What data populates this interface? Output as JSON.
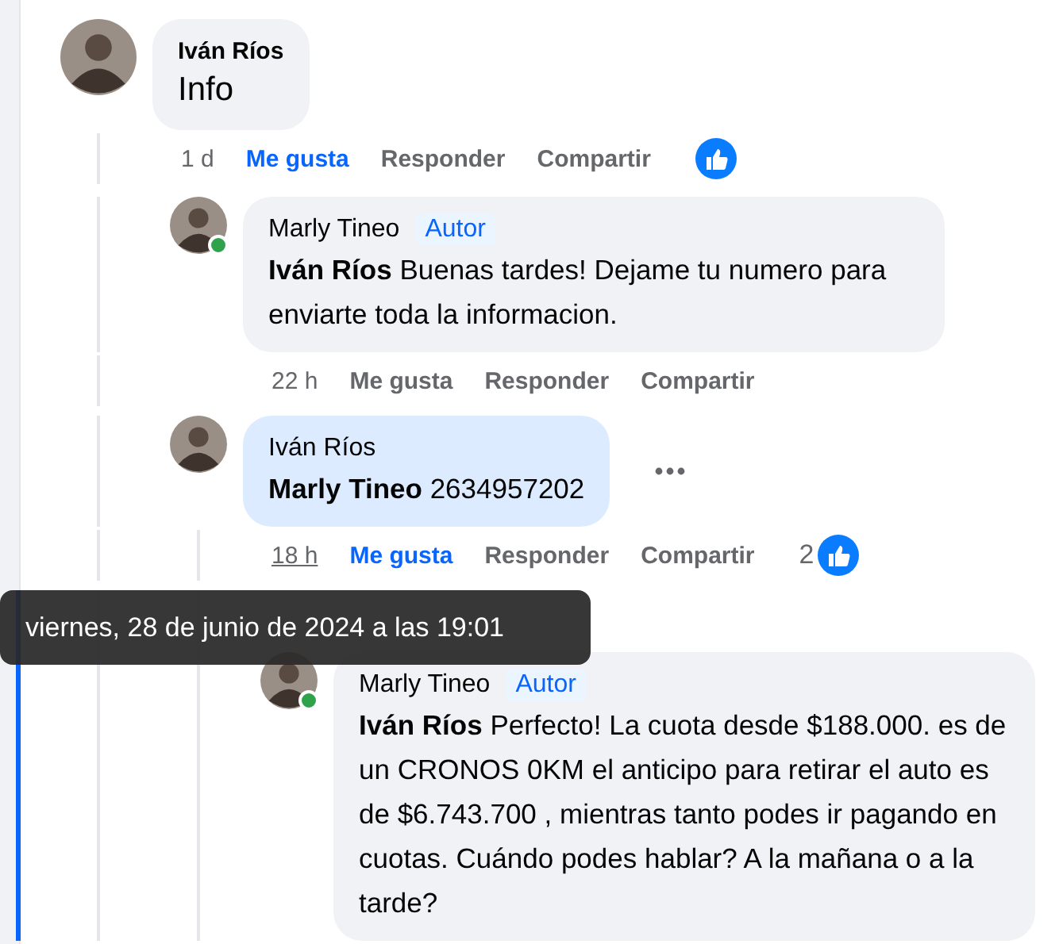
{
  "comments": [
    {
      "author": "Iván Ríos",
      "text": "Info",
      "time": "1 d",
      "time_hovered": false,
      "liked": true,
      "like_label": "Me gusta",
      "reply_label": "Responder",
      "share_label": "Compartir",
      "reaction_shown": true,
      "children": [
        {
          "author": "Marly Tineo",
          "author_badge": "Autor",
          "online": true,
          "mention": "Iván Ríos",
          "text": "Buenas tardes! Dejame tu numero para enviarte toda la informacion.",
          "time": "22 h",
          "time_hovered": false,
          "liked": false,
          "like_label": "Me gusta",
          "reply_label": "Responder",
          "share_label": "Compartir"
        },
        {
          "author": "Iván Ríos",
          "highlighted": true,
          "mention": "Marly Tineo",
          "text": "2634957202",
          "time": "18 h",
          "time_hovered": true,
          "liked": true,
          "like_label": "Me gusta",
          "reply_label": "Responder",
          "share_label": "Compartir",
          "reaction_shown": true,
          "reaction_count": "2",
          "more_button": true,
          "children": [
            {
              "author": "Marly Tineo",
              "author_badge": "Autor",
              "online": true,
              "focused": true,
              "mention": "Iván Ríos",
              "text": "Perfecto! La cuota desde $188.000. es de un CRONOS 0KM el anticipo para retirar el auto es de $6.743.700 , mientras tanto podes ir pagando en cuotas. Cuándo podes hablar? A la mañana o a la tarde?"
            }
          ]
        }
      ]
    }
  ],
  "tooltip": {
    "text": "viernes, 28 de junio de 2024 a las 19:01"
  }
}
